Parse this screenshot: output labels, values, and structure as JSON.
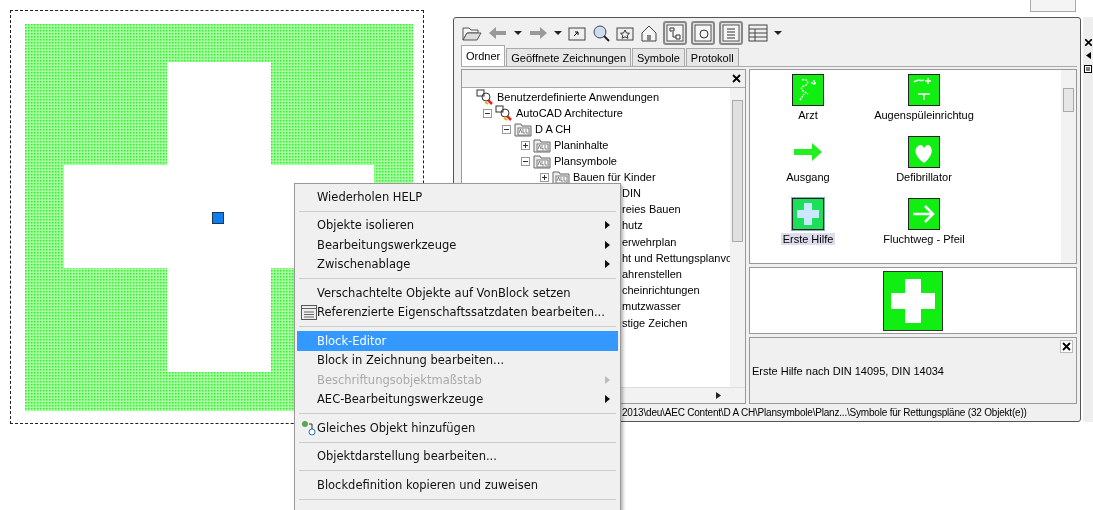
{
  "toolbar": [
    {
      "kind": "open"
    },
    {
      "kind": "back"
    },
    {
      "kind": "caret"
    },
    {
      "kind": "forward"
    },
    {
      "kind": "caret"
    },
    {
      "kind": "up"
    },
    {
      "kind": "search"
    },
    {
      "kind": "favorites"
    },
    {
      "kind": "home"
    },
    {
      "kind": "tree-toggle",
      "pressed": true
    },
    {
      "kind": "preview-toggle",
      "pressed": true
    },
    {
      "kind": "description-toggle",
      "pressed": true
    },
    {
      "kind": "views"
    },
    {
      "kind": "caret"
    }
  ],
  "tabs": [
    {
      "label": "Ordner",
      "selected": true
    },
    {
      "label": "Geöffnete Zeichnungen",
      "selected": false
    },
    {
      "label": "Symbole",
      "selected": false
    },
    {
      "label": "Protokoll",
      "selected": false
    }
  ],
  "tree": [
    {
      "label": "Benutzerdefinierte Anwendungen",
      "kind": "app",
      "children": [
        {
          "label": "AutoCAD Architecture",
          "kind": "app",
          "expanded": true,
          "children": [
            {
              "label": "D A CH",
              "kind": "folder",
              "expanded": true,
              "children": [
                {
                  "label": "Planinhalte",
                  "kind": "folder",
                  "expanded": false
                },
                {
                  "label": "Plansymbole",
                  "kind": "folder",
                  "expanded": true,
                  "children": [
                    {
                      "label": "Bauen für Kinder",
                      "kind": "folder",
                      "expanded": false
                    }
                  ]
                }
              ]
            }
          ]
        }
      ]
    }
  ],
  "tree_obscured_labels": [
    "DIN",
    "reies Bauen",
    "hutz",
    "erwehrplan",
    "ht und Rettungsplanvo",
    "ahrenstellen",
    "cheinrichtungen",
    "mutzwasser",
    "stige Zeichen"
  ],
  "symbols": [
    {
      "label": "Arzt",
      "kind": "doctor",
      "selected": false
    },
    {
      "label": "Augenspüleinrichtug",
      "kind": "eyewash",
      "selected": false
    },
    {
      "label": "Ausgang",
      "kind": "exit-arrow",
      "selected": false
    },
    {
      "label": "Defibrillator",
      "kind": "defibrillator",
      "selected": false
    },
    {
      "label": "Erste Hilfe",
      "kind": "first-aid",
      "selected": true
    },
    {
      "label": "Fluchtweg - Pfeil",
      "kind": "escape-arrow",
      "selected": false
    }
  ],
  "description": "Erste Hilfe nach DIN 14095, DIN 14034",
  "status_bar": "2013\\deu\\AEC Content\\D A CH\\Plansymbole\\Planz...\\Symbole für Rettungspläne (32 Objekt(e))",
  "context_menu": [
    {
      "kind": "item",
      "label": "Wiederholen HELP",
      "submenu": false,
      "disabled": false,
      "selected": false
    },
    {
      "kind": "separator"
    },
    {
      "kind": "item",
      "label": "Objekte isolieren",
      "submenu": true,
      "disabled": false,
      "selected": false
    },
    {
      "kind": "item",
      "label": "Bearbeitungswerkzeuge",
      "submenu": true,
      "disabled": false,
      "selected": false
    },
    {
      "kind": "item",
      "label": "Zwischenablage",
      "submenu": true,
      "disabled": false,
      "selected": false
    },
    {
      "kind": "separator"
    },
    {
      "kind": "item",
      "label": "Verschachtelte Objekte auf VonBlock setzen",
      "submenu": false,
      "disabled": false,
      "selected": false
    },
    {
      "kind": "properties",
      "label": "Referenzierte Eigenschaftssatzdaten bearbeiten...",
      "submenu": false,
      "disabled": false,
      "selected": false
    },
    {
      "kind": "separator"
    },
    {
      "kind": "item",
      "label": "Block-Editor",
      "submenu": false,
      "disabled": false,
      "selected": true
    },
    {
      "kind": "item",
      "label": "Block in Zeichnung bearbeiten...",
      "submenu": false,
      "disabled": false,
      "selected": false
    },
    {
      "kind": "item",
      "label": "Beschriftungsobjektmaßstab",
      "submenu": true,
      "disabled": true,
      "selected": false
    },
    {
      "kind": "item",
      "label": "AEC-Bearbeitungswerkzeuge",
      "submenu": true,
      "disabled": false,
      "selected": false
    },
    {
      "kind": "separator"
    },
    {
      "kind": "addsimilar",
      "label": "Gleiches Objekt hinzufügen",
      "submenu": false,
      "disabled": false,
      "selected": false
    },
    {
      "kind": "separator"
    },
    {
      "kind": "item",
      "label": "Objektdarstellung bearbeiten...",
      "submenu": false,
      "disabled": false,
      "selected": false
    },
    {
      "kind": "separator"
    },
    {
      "kind": "item",
      "label": "Blockdefinition kopieren und zuweisen",
      "submenu": false,
      "disabled": false,
      "selected": false
    },
    {
      "kind": "separator"
    }
  ]
}
